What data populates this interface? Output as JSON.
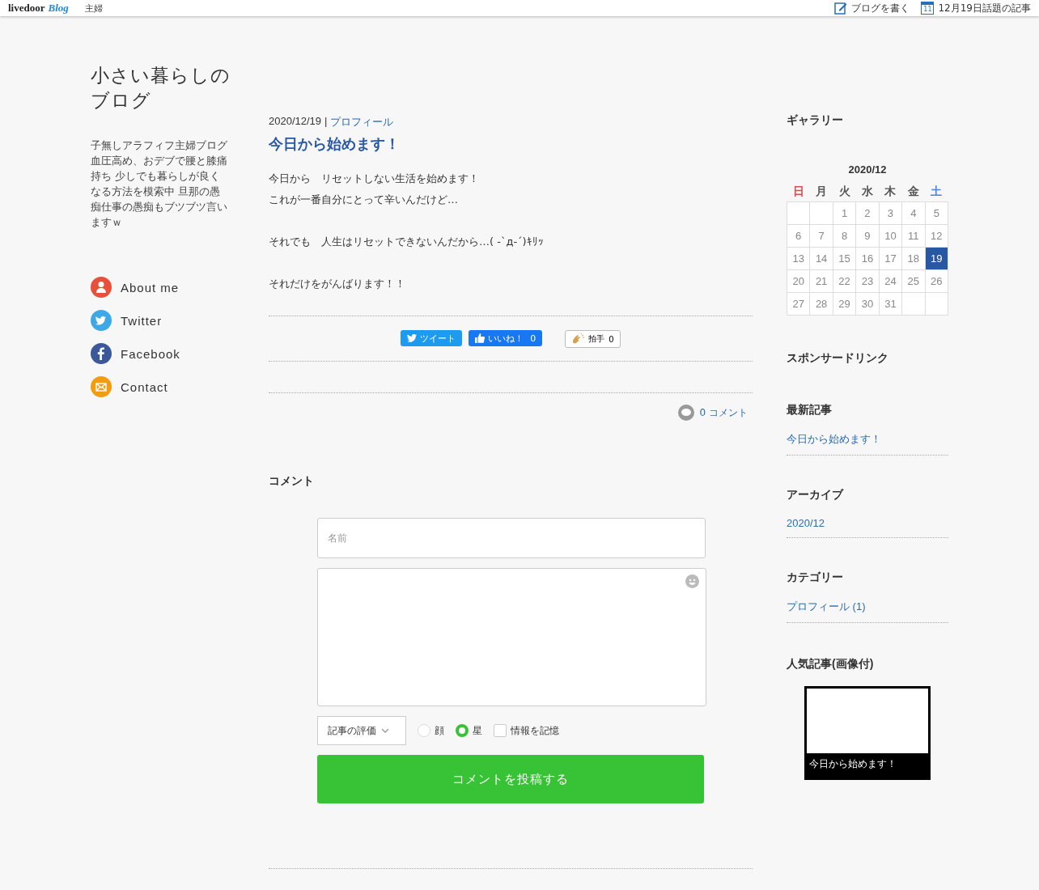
{
  "topbar": {
    "logo": "livedoor",
    "logo_sub": "Blog",
    "category": "主婦",
    "actions": [
      {
        "kind": "write",
        "label": "ブログを書く"
      },
      {
        "kind": "calendar",
        "label": "12月19日話題の記事",
        "icon_text": "11"
      }
    ]
  },
  "profile": {
    "title": "小さい暮らしのブログ",
    "description": "子無しアラフィフ主婦ブログ血圧高め、おデブで腰と膝痛持ち 少しでも暮らしが良くなる方法を模索中 旦那の愚痴仕事の愚痴もブツブツ言いますｗ",
    "links": [
      {
        "kind": "person",
        "label": "About me",
        "color": "#e8503a"
      },
      {
        "kind": "twitter",
        "label": "Twitter",
        "color": "#3ca8e6"
      },
      {
        "kind": "facebook",
        "label": "Facebook",
        "color": "#3b5998"
      },
      {
        "kind": "mail",
        "label": "Contact",
        "color": "#f29c12"
      }
    ]
  },
  "article": {
    "date": "2020/12/19",
    "separator": "|",
    "category": "プロフィール",
    "title": "今日から始めます！",
    "paragraphs": [
      [
        "今日から　リセットしない生活を始めます！",
        "これが一番自分にとって辛いんだけど…"
      ],
      [
        "それでも　人生はリセットできないんだから…( -`д-´)ｷﾘｯ"
      ],
      [
        "それだけをがんばります！！"
      ]
    ],
    "share": {
      "tweet": "ツイート",
      "like": "いいね！",
      "like_count": "0",
      "clap": "拍手",
      "clap_count": "0"
    },
    "comment_count": "0",
    "comment_link": "コメント"
  },
  "comment_form": {
    "heading": "コメント",
    "name_placeholder": "名前",
    "rating_select": "記事の評価",
    "rating_options": [
      {
        "label": "顔",
        "selected": false
      },
      {
        "label": "星",
        "selected": true
      }
    ],
    "remember": {
      "label": "情報を記憶",
      "checked": false
    },
    "submit": "コメントを投稿する"
  },
  "sidebar": {
    "gallery_heading": "ギャラリー",
    "calendar": {
      "month": "2020/12",
      "weekdays": [
        {
          "label": "日",
          "color": "#e04a4a"
        },
        {
          "label": "月",
          "color": "#555555"
        },
        {
          "label": "火",
          "color": "#555555"
        },
        {
          "label": "水",
          "color": "#555555"
        },
        {
          "label": "木",
          "color": "#555555"
        },
        {
          "label": "金",
          "color": "#555555"
        },
        {
          "label": "土",
          "color": "#4a86e0"
        }
      ],
      "weeks": [
        [
          {
            "kind": "blank"
          },
          {
            "kind": "blank"
          },
          {
            "kind": "day",
            "day": "1",
            "selected": false
          },
          {
            "kind": "day",
            "day": "2",
            "selected": false
          },
          {
            "kind": "day",
            "day": "3",
            "selected": false
          },
          {
            "kind": "day",
            "day": "4",
            "selected": false
          },
          {
            "kind": "day",
            "day": "5",
            "selected": false
          }
        ],
        [
          {
            "kind": "day",
            "day": "6",
            "selected": false
          },
          {
            "kind": "day",
            "day": "7",
            "selected": false
          },
          {
            "kind": "day",
            "day": "8",
            "selected": false
          },
          {
            "kind": "day",
            "day": "9",
            "selected": false
          },
          {
            "kind": "day",
            "day": "10",
            "selected": false
          },
          {
            "kind": "day",
            "day": "11",
            "selected": false
          },
          {
            "kind": "day",
            "day": "12",
            "selected": false
          }
        ],
        [
          {
            "kind": "day",
            "day": "13",
            "selected": false
          },
          {
            "kind": "day",
            "day": "14",
            "selected": false
          },
          {
            "kind": "day",
            "day": "15",
            "selected": false
          },
          {
            "kind": "day",
            "day": "16",
            "selected": false
          },
          {
            "kind": "day",
            "day": "17",
            "selected": false
          },
          {
            "kind": "day",
            "day": "18",
            "selected": false
          },
          {
            "kind": "day",
            "day": "19",
            "selected": true
          }
        ],
        [
          {
            "kind": "day",
            "day": "20",
            "selected": false
          },
          {
            "kind": "day",
            "day": "21",
            "selected": false
          },
          {
            "kind": "day",
            "day": "22",
            "selected": false
          },
          {
            "kind": "day",
            "day": "23",
            "selected": false
          },
          {
            "kind": "day",
            "day": "24",
            "selected": false
          },
          {
            "kind": "day",
            "day": "25",
            "selected": false
          },
          {
            "kind": "day",
            "day": "26",
            "selected": false
          }
        ],
        [
          {
            "kind": "day",
            "day": "27",
            "selected": false
          },
          {
            "kind": "day",
            "day": "28",
            "selected": false
          },
          {
            "kind": "day",
            "day": "29",
            "selected": false
          },
          {
            "kind": "day",
            "day": "30",
            "selected": false
          },
          {
            "kind": "day",
            "day": "31",
            "selected": false
          },
          {
            "kind": "blank"
          },
          {
            "kind": "blank"
          }
        ]
      ]
    },
    "sponsor_heading": "スポンサードリンク",
    "sections": [
      {
        "heading": "最新記事",
        "links": [
          "今日から始めます！"
        ]
      },
      {
        "heading": "アーカイブ",
        "links": [
          "2020/12"
        ]
      },
      {
        "heading": "カテゴリー",
        "links": [
          "プロフィール (1)"
        ]
      }
    ],
    "popular": {
      "heading": "人気記事(画像付)",
      "caption": "今日から始めます！"
    }
  }
}
